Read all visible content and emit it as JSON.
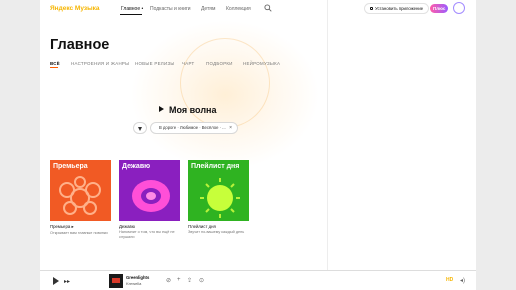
{
  "header": {
    "logo": "Яндекс Музыка",
    "nav": [
      {
        "label": "Главное",
        "active": true
      },
      {
        "label": "Подкасты и книги",
        "active": false
      },
      {
        "label": "Детям",
        "active": false
      },
      {
        "label": "Коллекция",
        "active": false
      }
    ],
    "install_label": "Установить приложение",
    "plus_label": "Плюс"
  },
  "main": {
    "title": "Главное",
    "tabs": [
      {
        "label": "ВСЁ",
        "active": true
      },
      {
        "label": "НАСТРОЕНИЯ И ЖАНРЫ",
        "active": false
      },
      {
        "label": "НОВЫЕ РЕЛИЗЫ",
        "active": false
      },
      {
        "label": "ЧАРТ",
        "active": false
      },
      {
        "label": "ПОДБОРКИ",
        "active": false
      },
      {
        "label": "НЕЙРОМУЗЫКА",
        "active": false
      }
    ],
    "wave_label": "Моя волна",
    "wave_filter": "В дороге · Любимое · Весёлое · ...",
    "cards": [
      {
        "cover_title": "Премьера",
        "name": "Премьера",
        "desc": "Открывает вам главные новинки",
        "color": "#f15a24"
      },
      {
        "cover_title": "Дежавю",
        "name": "Дежавю",
        "desc": "Напомнит о том, что вы ещё не слушали",
        "color": "#8a1fbf"
      },
      {
        "cover_title": "Плейлист дня",
        "name": "Плейлист дня",
        "desc": "Звучит по-вашему каждый день",
        "color": "#2fb321"
      }
    ]
  },
  "player": {
    "track": "Greenlights",
    "artist": "Krewella",
    "quality": "HD",
    "colors": {
      "accent": "#f6b500",
      "brand_tab": "#ff5c00"
    }
  }
}
